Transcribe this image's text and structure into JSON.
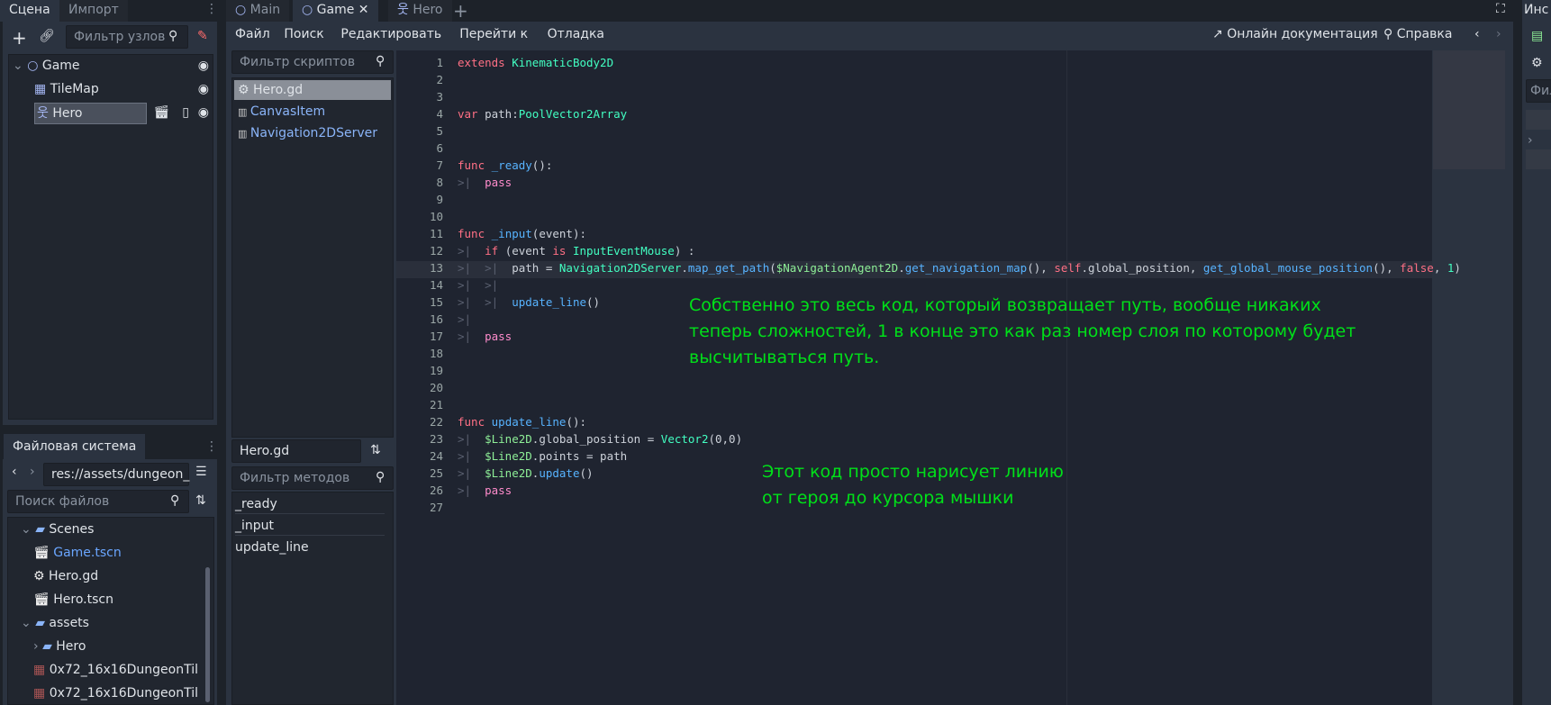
{
  "scene_dock": {
    "tabs": [
      "Сцена",
      "Импорт"
    ],
    "filter_placeholder": "Фильтр узлов",
    "nodes": [
      {
        "label": "Game",
        "icon": "node2d-icon"
      },
      {
        "label": "TileMap",
        "icon": "tilemap-icon"
      },
      {
        "label": "Hero",
        "icon": "kinematic-body-icon"
      }
    ]
  },
  "filesystem": {
    "tab": "Файловая система",
    "path": "res://assets/dungeon_",
    "search_placeholder": "Поиск файлов",
    "items": [
      {
        "label": "Scenes",
        "type": "folder"
      },
      {
        "label": "Game.tscn",
        "type": "scene"
      },
      {
        "label": "Hero.gd",
        "type": "script"
      },
      {
        "label": "Hero.tscn",
        "type": "scene"
      },
      {
        "label": "assets",
        "type": "folder"
      },
      {
        "label": "Hero",
        "type": "folder"
      },
      {
        "label": "0x72_16x16DungeonTil",
        "type": "image"
      },
      {
        "label": "0x72_16x16DungeonTil",
        "type": "image"
      }
    ]
  },
  "editor_tabs": [
    "Main",
    "Game",
    "Hero"
  ],
  "menu": [
    "Файл",
    "Поиск",
    "Редактировать",
    "Перейти к",
    "Отладка"
  ],
  "toolbar": {
    "online_docs": "Онлайн документация",
    "help": "Справка"
  },
  "scripts": {
    "filter_placeholder": "Фильтр скриптов",
    "items": [
      "Hero.gd",
      "CanvasItem",
      "Navigation2DServer"
    ],
    "current": "Hero.gd",
    "methods_placeholder": "Фильтр методов",
    "methods": [
      "_ready",
      "_input",
      "update_line"
    ]
  },
  "right_dock": {
    "tab": "Инс",
    "filter": "Фил"
  },
  "code": [
    [
      [
        "extends ",
        "k"
      ],
      [
        "KinematicBody2D",
        "t"
      ]
    ],
    [],
    [],
    [
      [
        "var ",
        "k"
      ],
      [
        "path:",
        "s"
      ],
      [
        "PoolVector2Array",
        "t"
      ]
    ],
    [],
    [],
    [
      [
        "func ",
        "k"
      ],
      [
        "_ready",
        "f"
      ],
      [
        "():",
        "s"
      ]
    ],
    [
      [
        "pass",
        "p"
      ]
    ],
    [],
    [],
    [
      [
        "func ",
        "k"
      ],
      [
        "_input",
        "f"
      ],
      [
        "(event):",
        "s"
      ]
    ],
    [
      [
        "if ",
        "k"
      ],
      [
        "(event ",
        "s"
      ],
      [
        "is ",
        "k"
      ],
      [
        "InputEventMouse",
        "t"
      ],
      [
        ") :",
        "s"
      ]
    ],
    [
      [
        "path = ",
        "s"
      ],
      [
        "Navigation2DServer",
        "t"
      ],
      [
        ".",
        "s"
      ],
      [
        "map_get_path",
        "f"
      ],
      [
        "(",
        "s"
      ],
      [
        "$NavigationAgent2D",
        "n"
      ],
      [
        ".",
        "s"
      ],
      [
        "get_navigation_map",
        "f"
      ],
      [
        "(), ",
        "s"
      ],
      [
        "self",
        "k"
      ],
      [
        ".global_position, ",
        "s"
      ],
      [
        "get_global_mouse_position",
        "f"
      ],
      [
        "(), ",
        "s"
      ],
      [
        "false",
        "k"
      ],
      [
        ", ",
        "s"
      ],
      [
        "1",
        "t"
      ],
      [
        ")",
        "s"
      ]
    ],
    [],
    [
      [
        "update_line",
        "f"
      ],
      [
        "()",
        "s"
      ]
    ],
    [],
    [
      [
        "pass",
        "p"
      ]
    ],
    [],
    [],
    [],
    [],
    [
      [
        "func ",
        "k"
      ],
      [
        "update_line",
        "f"
      ],
      [
        "():",
        "s"
      ]
    ],
    [
      [
        "$Line2D",
        "n"
      ],
      [
        ".global_position = ",
        "s"
      ],
      [
        "Vector2",
        "t"
      ],
      [
        "(0,0)",
        "s"
      ]
    ],
    [
      [
        "$Line2D",
        "n"
      ],
      [
        ".points = path",
        "s"
      ]
    ],
    [
      [
        "$Line2D",
        "n"
      ],
      [
        ".",
        "s"
      ],
      [
        "update",
        "f"
      ],
      [
        "()",
        "s"
      ]
    ],
    [
      [
        "pass",
        "p"
      ]
    ],
    []
  ],
  "indent": [
    0,
    0,
    0,
    0,
    0,
    0,
    0,
    1,
    0,
    0,
    0,
    1,
    2,
    2,
    2,
    1,
    1,
    0,
    0,
    0,
    0,
    0,
    1,
    1,
    1,
    1,
    0
  ],
  "notes": [
    "Собственно это весь код, который возвращает путь, вообще никаких",
    "теперь сложностей, 1 в конце это как раз номер слоя по которому будет",
    "высчитываться путь.",
    "Этот код просто нарисует линию",
    "от героя до курсора мышки"
  ]
}
